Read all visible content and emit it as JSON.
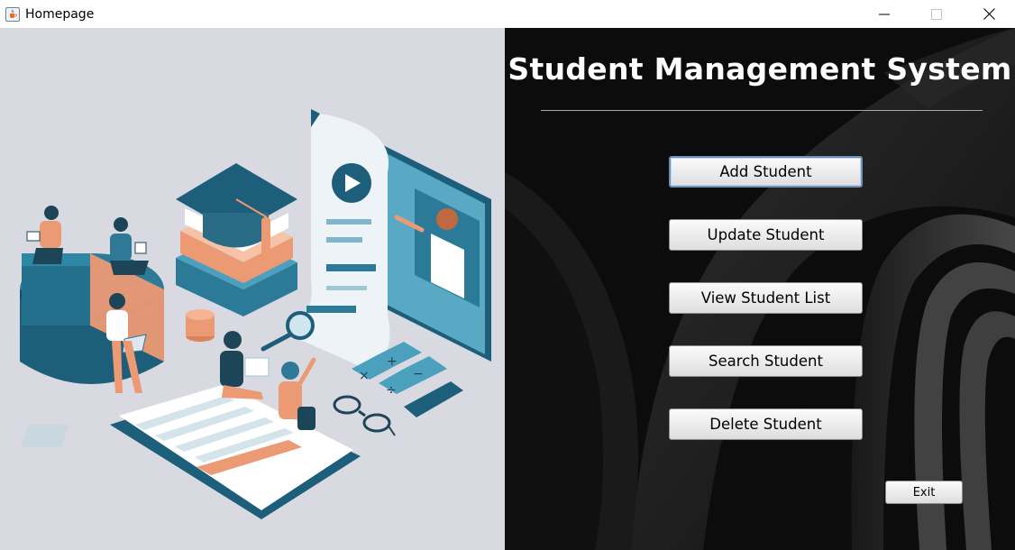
{
  "window": {
    "title": "Homepage",
    "icons": [
      "java-cup-icon",
      "minimize-icon",
      "maximize-icon",
      "close-icon"
    ]
  },
  "illustration": {
    "description_icon": "education-illustration",
    "colors": {
      "background": "#d9dae1",
      "teal": "#1d5f7a",
      "orange": "#ec9a74"
    }
  },
  "main": {
    "title": "Student Management System",
    "buttons": [
      {
        "label": "Add Student"
      },
      {
        "label": "Update Student"
      },
      {
        "label": "View Student List"
      },
      {
        "label": "Search Student"
      },
      {
        "label": "Delete Student"
      }
    ],
    "exit_label": "Exit",
    "colors": {
      "background": "#0c0c0c",
      "title": "#ffffff"
    }
  }
}
